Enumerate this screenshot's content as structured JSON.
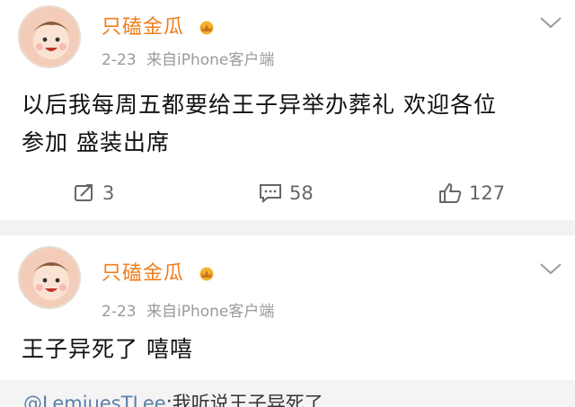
{
  "posts": [
    {
      "username": "只磕金瓜",
      "timestamp": "2-23",
      "source": "来自iPhone客户端",
      "content_line1": "以后我每周五都要给王子异举办葬礼 欢迎各位",
      "content_line2": "参加 盛装出席",
      "actions": {
        "repost_count": "3",
        "comment_count": "58",
        "like_count": "127"
      }
    },
    {
      "username": "只磕金瓜",
      "timestamp": "2-23",
      "source": "来自iPhone客户端",
      "content_line1": "王子异死了 嘻嘻",
      "quote": {
        "mention": "@LemjuesTLee",
        "text": ":我听说王子异死了"
      }
    }
  ],
  "colors": {
    "username": "#f07d1a",
    "meta": "#9a9a9a",
    "mention": "#5b7ea8",
    "divider": "#f2f2f2"
  },
  "icons": [
    "repost-icon",
    "comment-icon",
    "like-icon",
    "chevron-down-icon",
    "crown-badge-icon"
  ]
}
